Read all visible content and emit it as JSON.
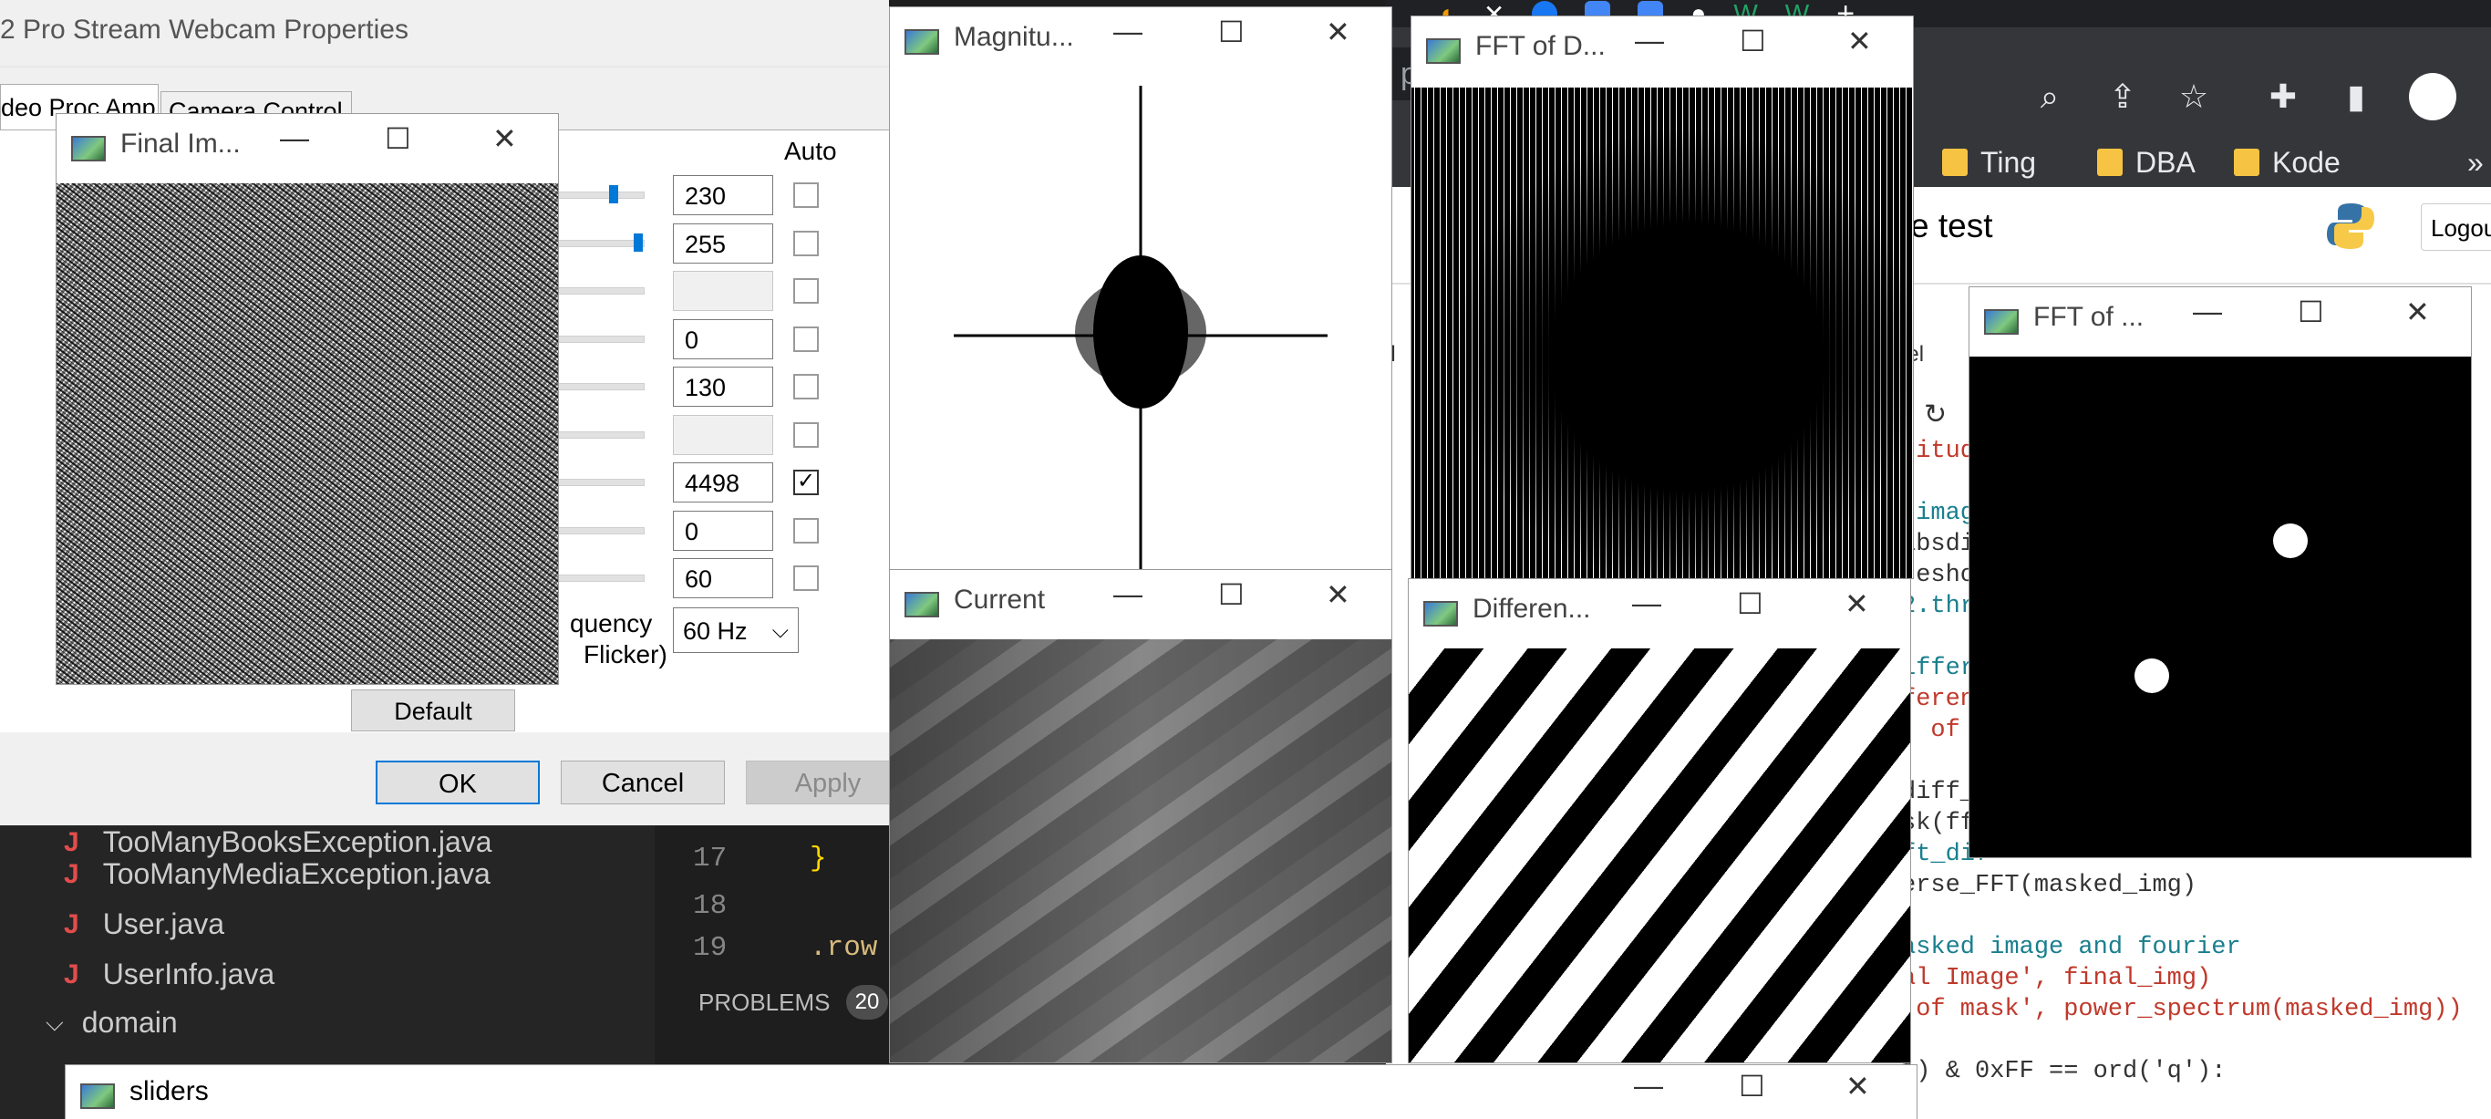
{
  "chrome": {
    "omnibox_text": "pte...",
    "bookmarks": [
      "Ting",
      "DBA",
      "Kode"
    ],
    "bookmarks_more": "»",
    "page_title": "e test",
    "logout_label": "Logou",
    "partial_text_kernel": "rnel",
    "partial_text_il": "il"
  },
  "code_lines": [
    {
      "text": "nitude",
      "color": "#c0392b"
    },
    {
      "text": "",
      "color": "#333"
    },
    {
      "text": " imag",
      "color": "#1a7f8e"
    },
    {
      "text": "absdi",
      "color": "#333"
    },
    {
      "text": "resho",
      "color": "#333"
    },
    {
      "text": "2.thr",
      "color": "#1a7f8e"
    },
    {
      "text": "",
      "color": "#333"
    },
    {
      "text": "iffer",
      "color": "#1a7f8e"
    },
    {
      "text": "feren",
      "color": "#c0392b"
    },
    {
      "text": ". of D",
      "color": "#c0392b"
    },
    {
      "text": "",
      "color": "#333"
    },
    {
      "text": "diff_",
      "color": "#333"
    },
    {
      "text": "sk(ff",
      "color": "#333"
    },
    {
      "text": "ft_dif",
      "color": "#1a7f8e"
    },
    {
      "text": "erse_FFT(masked_img)",
      "color": "#333"
    },
    {
      "text": "",
      "color": "#333"
    },
    {
      "text": "asked image and fourier",
      "color": "#1a7f8e"
    },
    {
      "text": "al Image', final_img)",
      "color": "#c0392b"
    },
    {
      "text": " of mask', power_spectrum(masked_img))",
      "color": "#c0392b"
    },
    {
      "text": "",
      "color": "#333"
    },
    {
      "text": "1) & 0xFF == ord('q'):",
      "color": "#333"
    }
  ],
  "vscode": {
    "files": [
      "TooManyBooksException.java",
      "TooManyMediaException.java",
      "User.java",
      "UserInfo.java"
    ],
    "folder": "domain",
    "line_numbers": [
      "17",
      "18",
      "19"
    ],
    "code_17": "}",
    "code_19": ".row",
    "problems_label": "PROBLEMS",
    "problems_count": "20"
  },
  "props": {
    "title": "2 Pro Stream Webcam Properties",
    "tabs": [
      "deo Proc Amp",
      "Camera Control"
    ],
    "auto_label": "Auto",
    "values": [
      "230",
      "255",
      "",
      "0",
      "130",
      "",
      "4498",
      "0",
      "60"
    ],
    "checked": [
      false,
      false,
      false,
      false,
      false,
      false,
      true,
      false,
      false
    ],
    "slider_levels": [
      0.28,
      0.0
    ],
    "freq_label_1": "quency",
    "freq_label_2": "Flicker)",
    "freq_select": "60 Hz",
    "default_button": "Default",
    "ok_button": "OK",
    "cancel_button": "Cancel",
    "apply_button": "Apply"
  },
  "windows": {
    "final_image": "Final Im...",
    "magnitude": "Magnitu...",
    "fft_d": "FFT of D...",
    "fft_mask": "FFT of ...",
    "current": "Current",
    "difference": "Differen...",
    "sliders": "sliders"
  }
}
